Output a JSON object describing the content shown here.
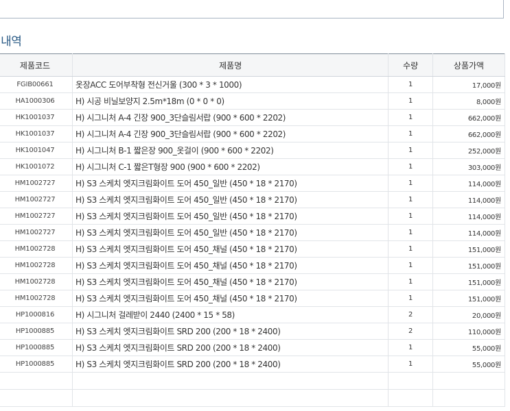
{
  "section": {
    "title": "세내역"
  },
  "table": {
    "headers": {
      "code": "제품코드",
      "name": "제품명",
      "qty": "수량",
      "amount": "상품가액"
    },
    "rows": [
      {
        "code": "FGIB00661",
        "name": "옷장ACC 도어부착형 전신거울 (300 * 3 * 1000)",
        "qty": "1",
        "amount": "17,000원"
      },
      {
        "code": "HA1000306",
        "name": "H) 시공 비닐보양지 2.5m*18m (0 * 0 * 0)",
        "qty": "1",
        "amount": "8,000원"
      },
      {
        "code": "HK1001037",
        "name": "H) 시그니처 A-4 긴장 900_3단슬림서랍 (900 * 600 * 2202)",
        "qty": "1",
        "amount": "662,000원"
      },
      {
        "code": "HK1001037",
        "name": "H) 시그니처 A-4 긴장 900_3단슬림서랍 (900 * 600 * 2202)",
        "qty": "1",
        "amount": "662,000원"
      },
      {
        "code": "HK1001047",
        "name": "H) 시그니처 B-1 짧은장 900_옷걸이 (900 * 600 * 2202)",
        "qty": "1",
        "amount": "252,000원"
      },
      {
        "code": "HK1001072",
        "name": "H) 시그니처 C-1 짧은T형장 900 (900 * 600 * 2202)",
        "qty": "1",
        "amount": "303,000원"
      },
      {
        "code": "HM1002727",
        "name": "H) S3 스케치 엣지크림화이트 도어 450_일반 (450 * 18 * 2170)",
        "qty": "1",
        "amount": "114,000원"
      },
      {
        "code": "HM1002727",
        "name": "H) S3 스케치 엣지크림화이트 도어 450_일반 (450 * 18 * 2170)",
        "qty": "1",
        "amount": "114,000원"
      },
      {
        "code": "HM1002727",
        "name": "H) S3 스케치 엣지크림화이트 도어 450_일반 (450 * 18 * 2170)",
        "qty": "1",
        "amount": "114,000원"
      },
      {
        "code": "HM1002727",
        "name": "H) S3 스케치 엣지크림화이트 도어 450_일반 (450 * 18 * 2170)",
        "qty": "1",
        "amount": "114,000원"
      },
      {
        "code": "HM1002728",
        "name": "H) S3 스케치 엣지크림화이트 도어 450_채널 (450 * 18 * 2170)",
        "qty": "1",
        "amount": "151,000원"
      },
      {
        "code": "HM1002728",
        "name": "H) S3 스케치 엣지크림화이트 도어 450_채널 (450 * 18 * 2170)",
        "qty": "1",
        "amount": "151,000원"
      },
      {
        "code": "HM1002728",
        "name": "H) S3 스케치 엣지크림화이트 도어 450_채널 (450 * 18 * 2170)",
        "qty": "1",
        "amount": "151,000원"
      },
      {
        "code": "HM1002728",
        "name": "H) S3 스케치 엣지크림화이트 도어 450_채널 (450 * 18 * 2170)",
        "qty": "1",
        "amount": "151,000원"
      },
      {
        "code": "HP1000816",
        "name": "H) 시그니처 걸레받이 2440 (2400 * 15 * 58)",
        "qty": "2",
        "amount": "20,000원"
      },
      {
        "code": "HP1000885",
        "name": "H) S3 스케치 엣지크림화이트 SRD 200 (200 * 18 * 2400)",
        "qty": "2",
        "amount": "110,000원"
      },
      {
        "code": "HP1000885",
        "name": "H) S3 스케치 엣지크림화이트 SRD 200 (200 * 18 * 2400)",
        "qty": "1",
        "amount": "55,000원"
      },
      {
        "code": "HP1000885",
        "name": "H) S3 스케치 엣지크림화이트 SRD 200 (200 * 18 * 2400)",
        "qty": "1",
        "amount": "55,000원"
      }
    ]
  }
}
